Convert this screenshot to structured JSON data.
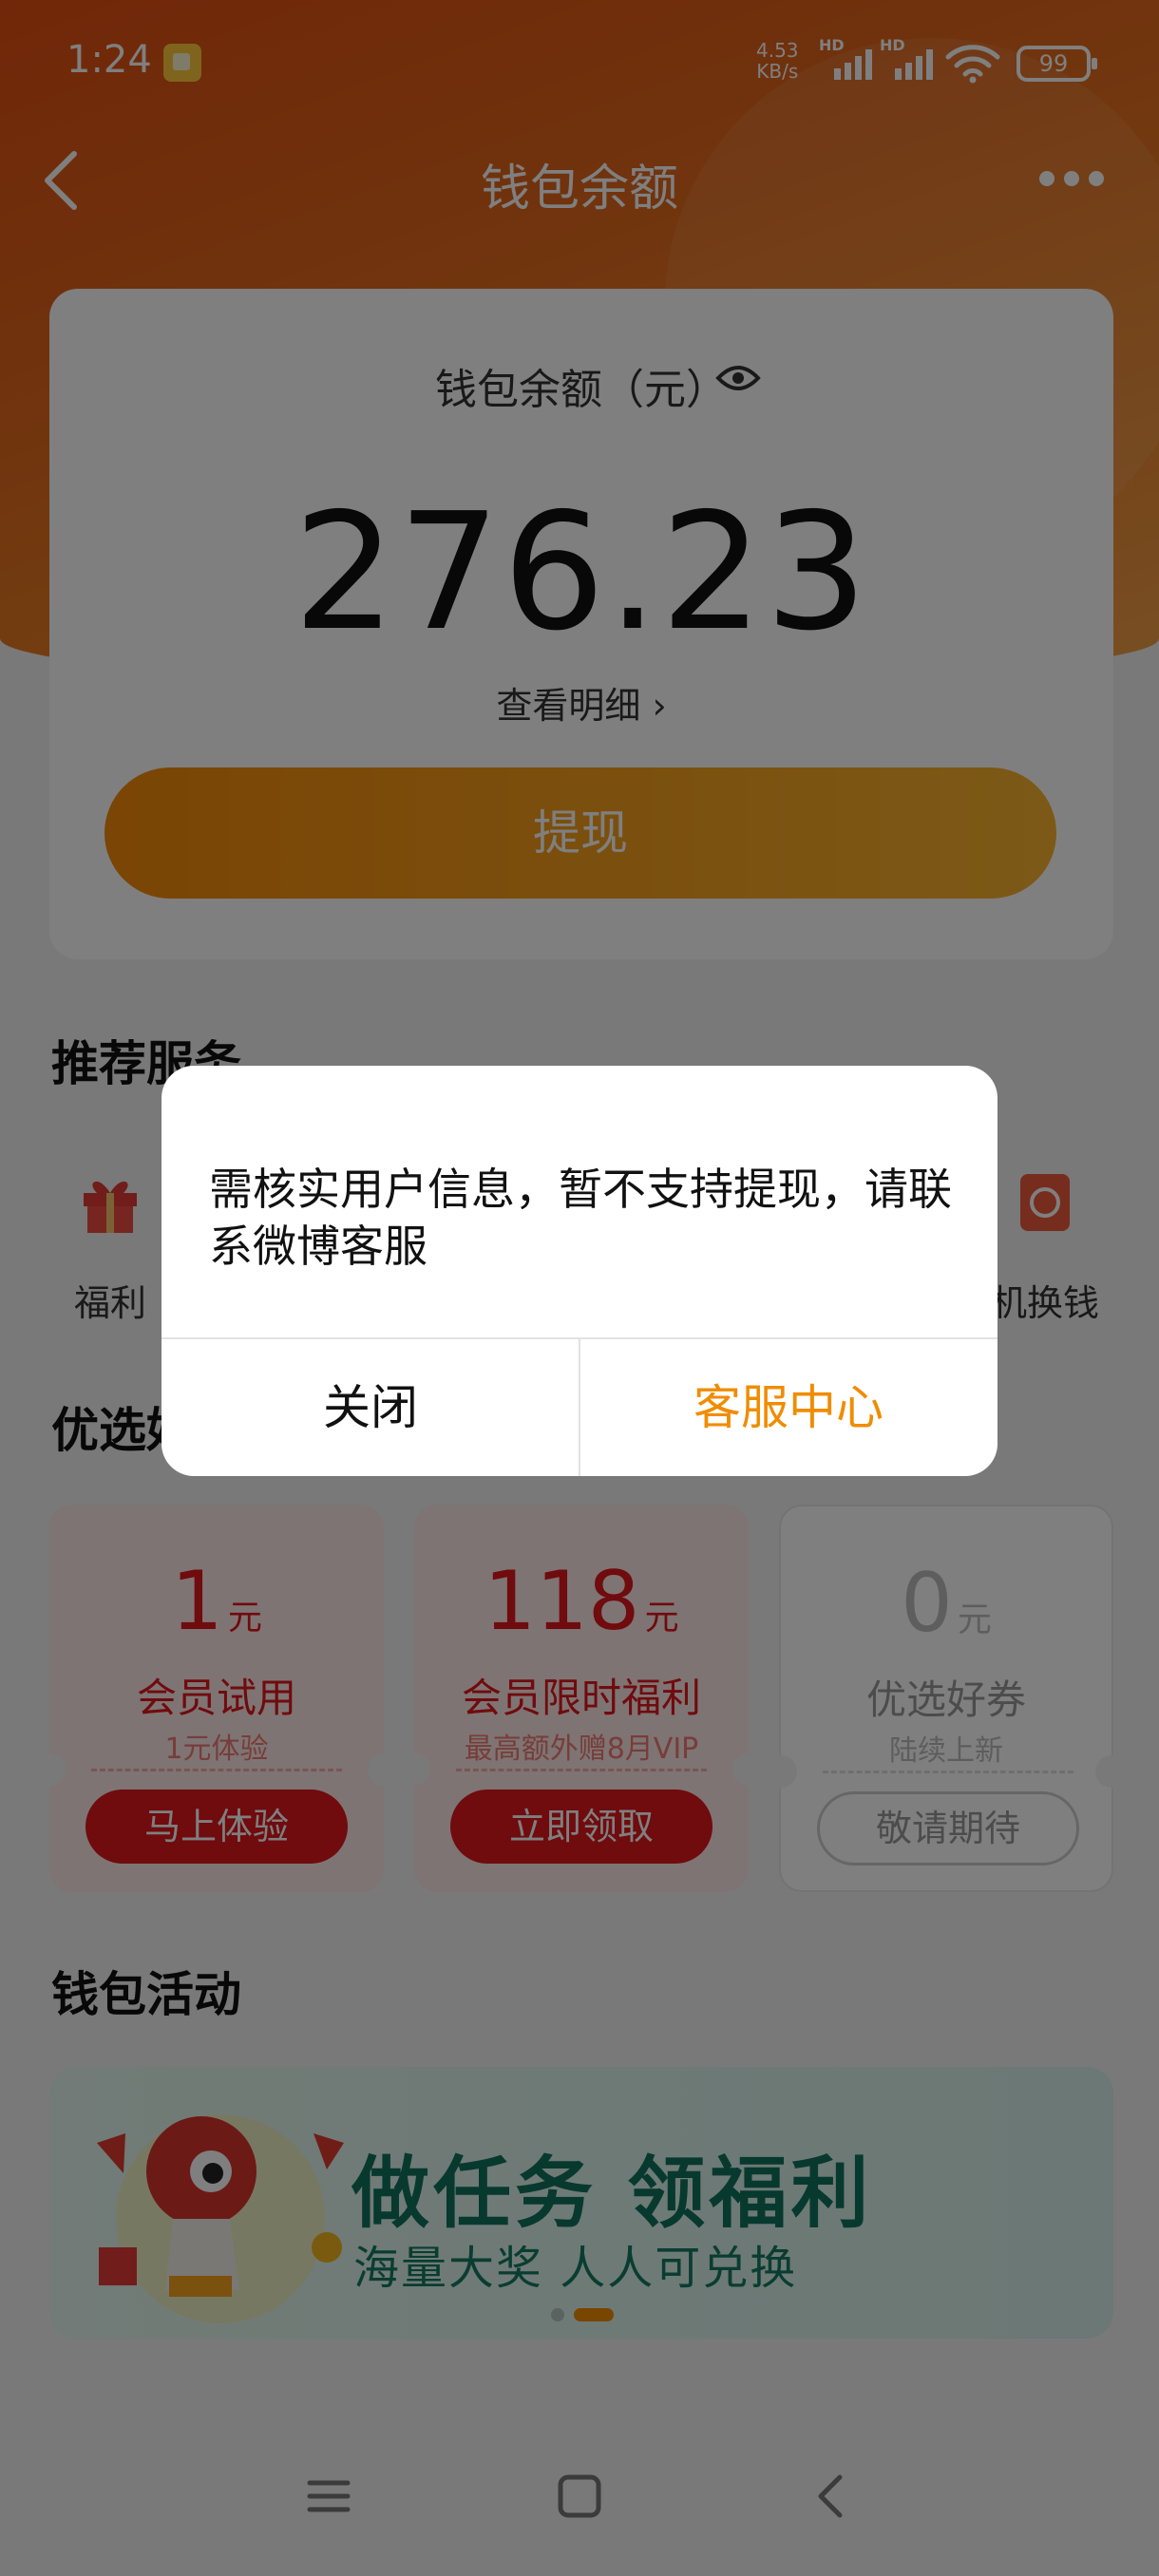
{
  "status_bar": {
    "time": "1:24",
    "net_speed_value": "4.53",
    "net_speed_unit": "KB/s",
    "signal_label": "HD",
    "battery": "99"
  },
  "nav": {
    "title": "钱包余额"
  },
  "balance_card": {
    "label": "钱包余额（元）",
    "amount": "276.23",
    "details_link": "查看明细 ›",
    "withdraw_button": "提现"
  },
  "recommended": {
    "title": "推荐服务",
    "items": [
      {
        "label": "福利",
        "icon": "gift-icon"
      },
      {
        "label": "机换钱",
        "icon": "exchange-icon"
      }
    ]
  },
  "preferred": {
    "title": "优选好",
    "coupons": [
      {
        "value": "1",
        "unit": "元",
        "name": "会员试用",
        "sub": "1元体验",
        "button": "马上体验"
      },
      {
        "value": "118",
        "unit": "元",
        "name": "会员限时福利",
        "sub": "最高额外赠8月VIP",
        "button": "立即领取"
      },
      {
        "value": "0",
        "unit": "元",
        "name": "优选好券",
        "sub": "陆续上新",
        "button": "敬请期待"
      }
    ]
  },
  "activity": {
    "title": "钱包活动",
    "banner_title": "做任务 领福利",
    "banner_subtitle": "海量大奖 人人可兑换"
  },
  "dialog": {
    "message": "需核实用户信息，暂不支持提现，请联系微博客服",
    "close_button": "关闭",
    "service_button": "客服中心"
  },
  "colors": {
    "primary_orange": "#f58a0a",
    "coupon_red": "#e1161c",
    "dialog_accent": "#f08c00"
  }
}
